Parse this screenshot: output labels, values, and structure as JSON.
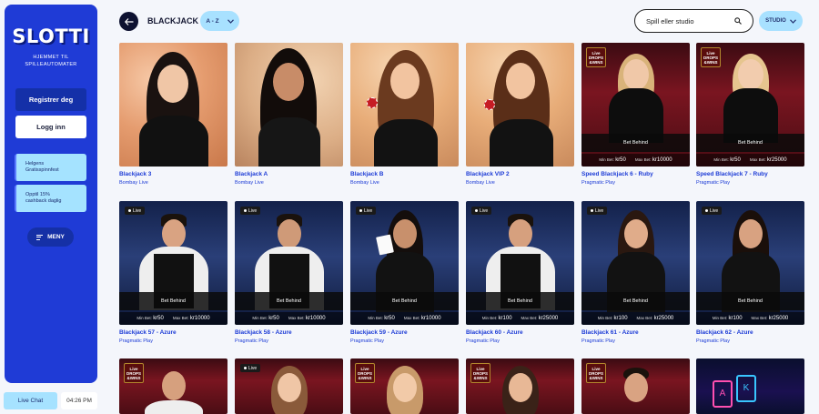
{
  "sidebar": {
    "logo": "SLOTTI",
    "tagline": "HJEMMET TIL SPILLEAUTOMATER",
    "register_label": "Registrer deg",
    "login_label": "Logg inn",
    "promos": [
      {
        "line1": "Helgens",
        "line2": "Gratisspinnfest"
      },
      {
        "line1": "Opptil 15%",
        "line2": "cashback daglig"
      }
    ],
    "menu_label": "MENY",
    "chat_label": "Live Chat",
    "clock": "04:26 PM"
  },
  "header": {
    "title": "BLACKJACK",
    "sort_label": "A - Z",
    "search_placeholder": "Spill eller studio",
    "studio_label": "STUDIO"
  },
  "games": [
    {
      "title": "Blackjack 3",
      "provider": "Bombay Live"
    },
    {
      "title": "Blackjack A",
      "provider": "Bombay Live"
    },
    {
      "title": "Blackjack B",
      "provider": "Bombay Live"
    },
    {
      "title": "Blackjack VIP 2",
      "provider": "Bombay Live"
    },
    {
      "title": "Speed Blackjack 6 - Ruby",
      "provider": "Pragmatic Play",
      "bet_behind": "Bet Behind",
      "min_label": "Min Bet:",
      "min": "kr50",
      "max_label": "Max Bet:",
      "max": "kr10000"
    },
    {
      "title": "Speed Blackjack 7 - Ruby",
      "provider": "Pragmatic Play",
      "bet_behind": "Bet Behind",
      "min_label": "Min Bet:",
      "min": "kr50",
      "max_label": "Max Bet:",
      "max": "kr25000"
    },
    {
      "title": "Blackjack 57 - Azure",
      "provider": "Pragmatic Play",
      "live": "Live",
      "bet_behind": "Bet Behind",
      "min_label": "Min Bet:",
      "min": "kr50",
      "max_label": "Max Bet:",
      "max": "kr10000"
    },
    {
      "title": "Blackjack 58 - Azure",
      "provider": "Pragmatic Play",
      "live": "Live",
      "bet_behind": "Bet Behind",
      "min_label": "Min Bet:",
      "min": "kr50",
      "max_label": "Max Bet:",
      "max": "kr10000"
    },
    {
      "title": "Blackjack 59 - Azure",
      "provider": "Pragmatic Play",
      "live": "Live",
      "bet_behind": "Bet Behind",
      "min_label": "Min Bet:",
      "min": "kr50",
      "max_label": "Max Bet:",
      "max": "kr10000"
    },
    {
      "title": "Blackjack 60 - Azure",
      "provider": "Pragmatic Play",
      "live": "Live",
      "bet_behind": "Bet Behind",
      "min_label": "Min Bet:",
      "min": "kr100",
      "max_label": "Max Bet:",
      "max": "kr25000"
    },
    {
      "title": "Blackjack 61 - Azure",
      "provider": "Pragmatic Play",
      "live": "Live",
      "bet_behind": "Bet Behind",
      "min_label": "Min Bet:",
      "min": "kr100",
      "max_label": "Max Bet:",
      "max": "kr25000"
    },
    {
      "title": "Blackjack 62 - Azure",
      "provider": "Pragmatic Play",
      "live": "Live",
      "bet_behind": "Bet Behind",
      "min_label": "Min Bet:",
      "min": "kr100",
      "max_label": "Max Bet:",
      "max": "kr25000"
    }
  ],
  "partial_row": {
    "live": "Live",
    "drops_line1": "Live",
    "drops_line2": "DROPS",
    "drops_line3": "&WINS"
  }
}
